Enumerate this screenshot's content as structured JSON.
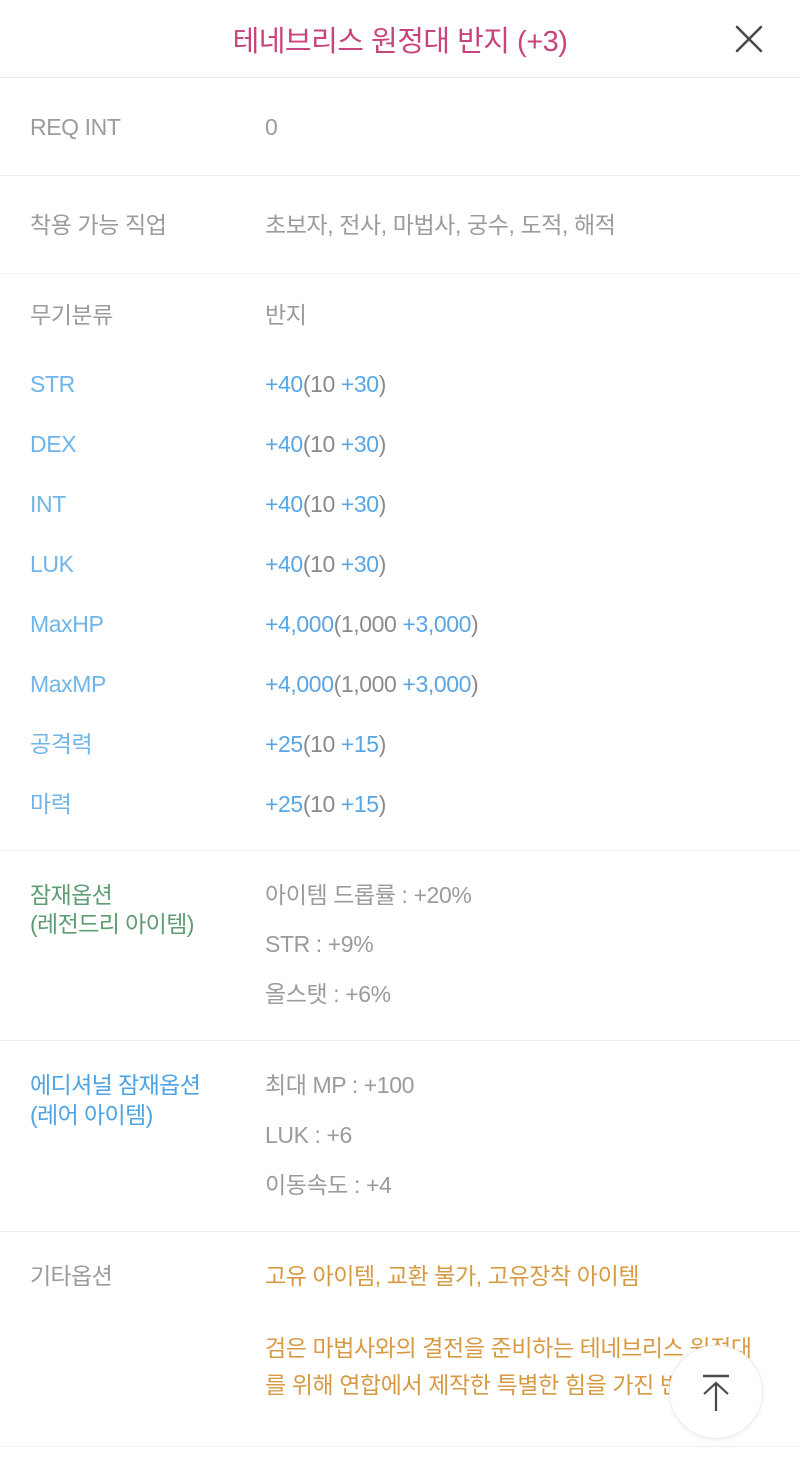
{
  "header": {
    "title": "테네브리스 원정대 반지 (+3)",
    "close_icon": "close-icon",
    "title_color": "#c8447c"
  },
  "info_rows": [
    {
      "label": "REQ INT",
      "value": "0"
    },
    {
      "label": "착용 가능 직업",
      "value": "초보자, 전사, 마법사, 궁수, 도적, 해적"
    }
  ],
  "category_row": {
    "label": "무기분류",
    "value": "반지"
  },
  "stats": [
    {
      "label": "STR",
      "total": "+40",
      "base": "(10 ",
      "inc": "+30",
      "close": ")"
    },
    {
      "label": "DEX",
      "total": "+40",
      "base": "(10 ",
      "inc": "+30",
      "close": ")"
    },
    {
      "label": "INT",
      "total": "+40",
      "base": "(10 ",
      "inc": "+30",
      "close": ")"
    },
    {
      "label": "LUK",
      "total": "+40",
      "base": "(10 ",
      "inc": "+30",
      "close": ")"
    },
    {
      "label": "MaxHP",
      "total": "+4,000",
      "base": "(1,000 ",
      "inc": "+3,000",
      "close": ")"
    },
    {
      "label": "MaxMP",
      "total": "+4,000",
      "base": "(1,000 ",
      "inc": "+3,000",
      "close": ")"
    },
    {
      "label": "공격력",
      "total": "+25",
      "base": "(10 ",
      "inc": "+15",
      "close": ")"
    },
    {
      "label": "마력",
      "total": "+25",
      "base": "(10 ",
      "inc": "+15",
      "close": ")"
    }
  ],
  "potential": {
    "label_line1": "잠재옵션",
    "label_line2": "(레전드리 아이템)",
    "label_color": "#5f9c72",
    "options": [
      "아이템 드롭률 : +20%",
      "STR : +9%",
      "올스탯 : +6%"
    ]
  },
  "additional_potential": {
    "label_line1": "에디셔널 잠재옵션",
    "label_line2": "(레어 아이템)",
    "label_color": "#4fa3e3",
    "options": [
      "최대 MP : +100",
      "LUK : +6",
      "이동속도 : +4"
    ]
  },
  "etc": {
    "label": "기타옵션",
    "value_color": "#d79a43",
    "flags": "고유 아이템, 교환 불가, 고유장착 아이템",
    "description": "검은 마법사와의 결전을 준비하는 테네브리스 원정대를 위해 연합에서 제작한 특별한 힘을 가진 반지이다."
  },
  "fab": {
    "icon": "scroll-to-top-icon"
  },
  "colors": {
    "stat_label": "#6fb5e8",
    "stat_increase": "#59a6e4",
    "stat_base": "#8b8b8b",
    "muted_text": "#9b9b9b",
    "divider": "#eeeeee"
  }
}
